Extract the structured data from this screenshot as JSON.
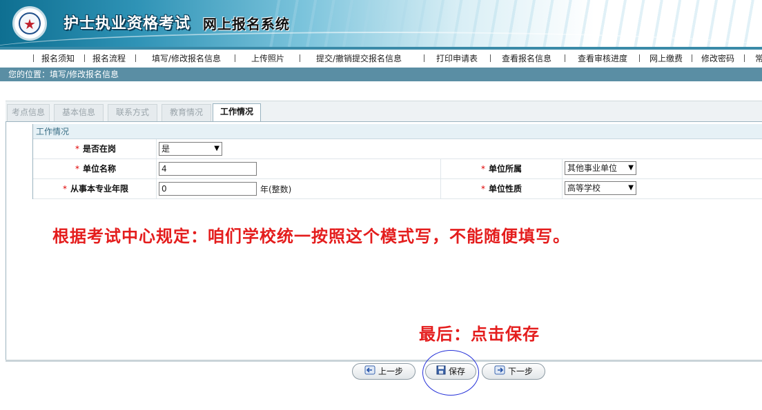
{
  "header": {
    "title_main": "护士执业资格考试",
    "title_sub": "网上报名系统"
  },
  "nav": {
    "items": [
      "报名须知",
      "报名流程",
      "填写/修改报名信息",
      "上传照片",
      "提交/撤销提交报名信息",
      "打印申请表",
      "查看报名信息",
      "查看审核进度",
      "网上缴费",
      "修改密码",
      "常"
    ]
  },
  "location": "您的位置：填写/修改报名信息",
  "tabs": [
    "考点信息",
    "基本信息",
    "联系方式",
    "教育情况",
    "工作情况"
  ],
  "form": {
    "section_title": "工作情况",
    "required_mark": "*",
    "fields": {
      "on_duty": {
        "label": "是否在岗",
        "value": "是"
      },
      "employer_name": {
        "label": "单位名称",
        "value": "4"
      },
      "employer_affiliation": {
        "label": "单位所属",
        "value": "其他事业单位"
      },
      "years": {
        "label": "从事本专业年限",
        "value": "0",
        "unit": "年(整数)"
      },
      "employer_type": {
        "label": "单位性质",
        "value": "高等学校"
      }
    }
  },
  "annotations": {
    "notice": "根据考试中心规定：咱们学校统一按照这个模式写，不能随便填写。",
    "final_step": "最后：点击保存"
  },
  "buttons": {
    "prev": "上一步",
    "save": "保存",
    "next": "下一步"
  },
  "colors": {
    "notice_red": "#e41d1d",
    "location_bar": "#5a8ea4",
    "circle_blue": "#2430d8"
  }
}
